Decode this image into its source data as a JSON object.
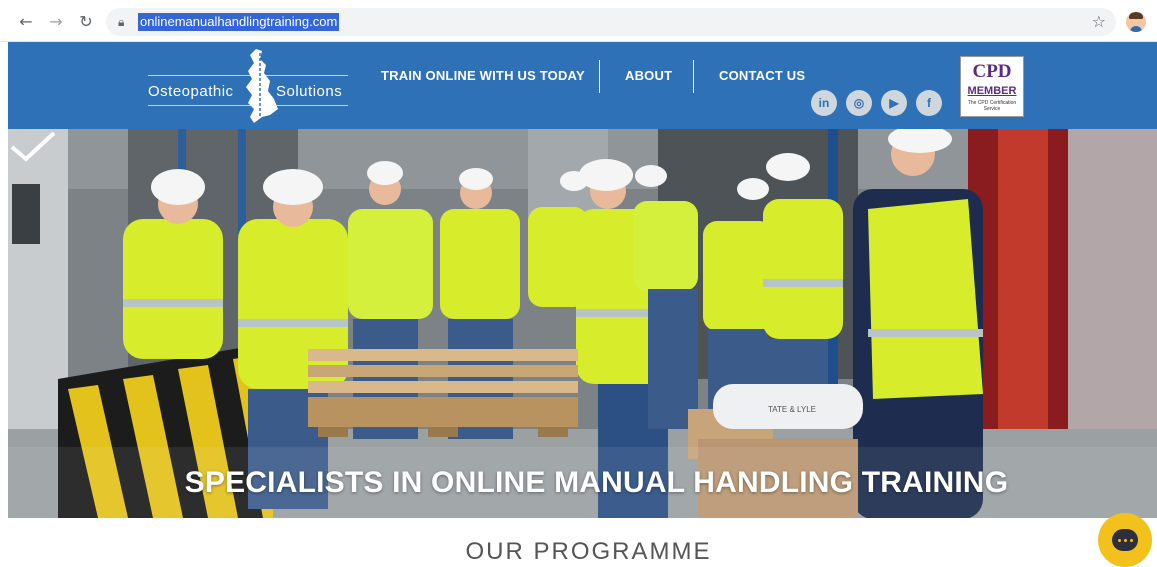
{
  "browser": {
    "url": "onlinemanualhandlingtraining.com",
    "icons": {
      "back": "back-arrow-icon",
      "forward": "forward-arrow-icon",
      "reload": "reload-icon",
      "lock": "lock-icon",
      "star": "star-icon",
      "profile": "profile-avatar"
    }
  },
  "header": {
    "logo": {
      "left_word": "Osteopathic",
      "right_word": "Solutions"
    },
    "menu": [
      {
        "label": "TRAIN ONLINE WITH US TODAY"
      },
      {
        "label": "ABOUT"
      },
      {
        "label": "CONTACT US"
      }
    ],
    "social": [
      {
        "name": "linkedin-icon",
        "glyph": "in"
      },
      {
        "name": "instagram-icon",
        "glyph": "◎"
      },
      {
        "name": "youtube-icon",
        "glyph": "▶"
      },
      {
        "name": "facebook-icon",
        "glyph": "f"
      }
    ],
    "cpd_badge": {
      "title": "CPD",
      "member": "MEMBER",
      "subtitle": "The CPD Certification Service"
    }
  },
  "hero": {
    "title": "SPECIALISTS IN ONLINE MANUAL HANDLING TRAINING",
    "sack_label": "TATE & LYLE"
  },
  "section": {
    "title": "OUR  PROGRAMME"
  },
  "colors": {
    "header_blue": "#2e71b6",
    "hivis_yellow": "#d7ec2a",
    "chat_yellow": "#f2c11b",
    "url_highlight": "#3367d6"
  }
}
